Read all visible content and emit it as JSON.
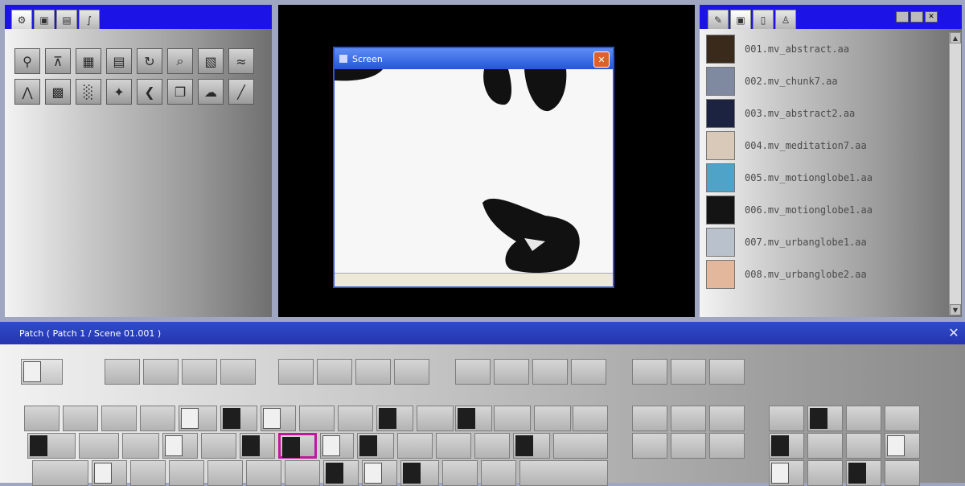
{
  "left_panel": {
    "tabs": [
      {
        "icon": "globe-icon",
        "glyph": "⚙",
        "active": true
      },
      {
        "icon": "image-icon",
        "glyph": "▣",
        "active": false
      },
      {
        "icon": "document-icon",
        "glyph": "▤",
        "active": false
      },
      {
        "icon": "brush-icon",
        "glyph": "∫",
        "active": false
      }
    ],
    "tools": [
      {
        "icon": "pin-icon",
        "glyph": "⚲"
      },
      {
        "icon": "tree-icon",
        "glyph": "⊼"
      },
      {
        "icon": "grid-icon",
        "glyph": "▦"
      },
      {
        "icon": "layers-icon",
        "glyph": "▤"
      },
      {
        "icon": "rotate-icon",
        "glyph": "↻"
      },
      {
        "icon": "zoom-icon",
        "glyph": "⌕"
      },
      {
        "icon": "picture-icon",
        "glyph": "▧"
      },
      {
        "icon": "wave-icon",
        "glyph": "≈"
      },
      {
        "icon": "figure-icon",
        "glyph": "⋀"
      },
      {
        "icon": "mosaic-icon",
        "glyph": "▩"
      },
      {
        "icon": "checker-icon",
        "glyph": "░"
      },
      {
        "icon": "plus-icon",
        "glyph": "✦"
      },
      {
        "icon": "chevron-left-icon",
        "glyph": "❮"
      },
      {
        "icon": "copy-icon",
        "glyph": "❐"
      },
      {
        "icon": "cloud-icon",
        "glyph": "☁"
      },
      {
        "icon": "slash-icon",
        "glyph": "╱"
      }
    ]
  },
  "viewer": {
    "window_title": "Screen",
    "close_icon": "close-icon"
  },
  "right_panel": {
    "tabs": [
      {
        "icon": "pencil-icon",
        "glyph": "✎",
        "active": false
      },
      {
        "icon": "monitor-icon",
        "glyph": "▣",
        "active": true
      },
      {
        "icon": "card-icon",
        "glyph": "▯",
        "active": false
      },
      {
        "icon": "person-icon",
        "glyph": "♙",
        "active": false
      }
    ],
    "window_buttons": [
      "minimize-icon",
      "restore-icon",
      "close-icon"
    ],
    "clips": [
      {
        "label": "001.mv_abstract.aa",
        "thumb_color": "#3a2a1c"
      },
      {
        "label": "002.mv_chunk7.aa",
        "thumb_color": "#7f8aa0"
      },
      {
        "label": "003.mv_abstract2.aa",
        "thumb_color": "#1b2340"
      },
      {
        "label": "004.mv_meditation7.aa",
        "thumb_color": "#d9c9b8"
      },
      {
        "label": "005.mv_motionglobe1.aa",
        "thumb_color": "#4fa3c9"
      },
      {
        "label": "006.mv_motionglobe1.aa",
        "thumb_color": "#141414"
      },
      {
        "label": "007.mv_urbanglobe1.aa",
        "thumb_color": "#b9c2cc"
      },
      {
        "label": "008.mv_urbanglobe2.aa",
        "thumb_color": "#e3b79c"
      }
    ]
  },
  "patch": {
    "title": "Patch ( Patch 1 / Scene 01.001 )",
    "close_glyph": "✕"
  },
  "colors": {
    "title_bar": "#1c14e6",
    "patch_bar": "#2f4cc8",
    "selection": "#c0189a"
  }
}
